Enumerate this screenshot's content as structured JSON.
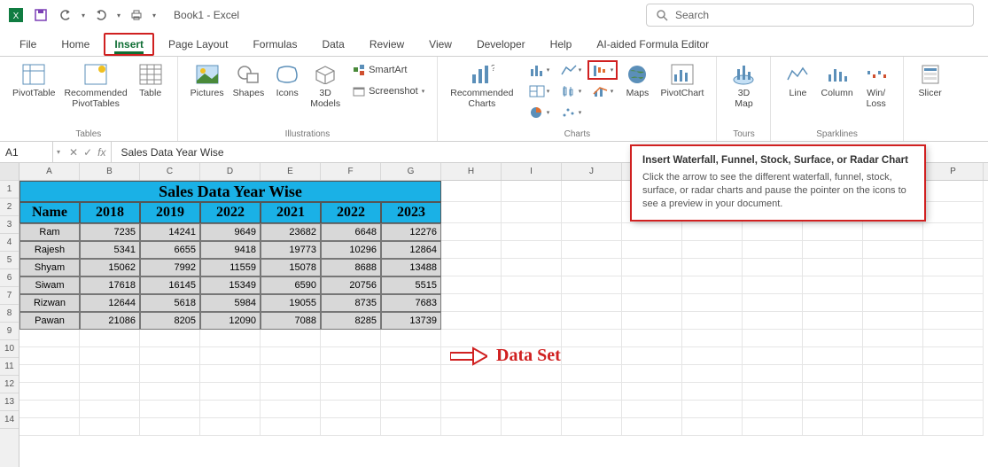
{
  "titlebar": {
    "doc_title": "Book1 - Excel",
    "search_placeholder": "Search"
  },
  "tabs": [
    "File",
    "Home",
    "Insert",
    "Page Layout",
    "Formulas",
    "Data",
    "Review",
    "View",
    "Developer",
    "Help",
    "AI-aided Formula Editor"
  ],
  "active_tab": "Insert",
  "ribbon": {
    "tables": {
      "label": "Tables",
      "pivot": "PivotTable",
      "recpivot": "Recommended\nPivotTables",
      "table": "Table"
    },
    "illus": {
      "label": "Illustrations",
      "pictures": "Pictures",
      "shapes": "Shapes",
      "icons": "Icons",
      "models": "3D\nModels",
      "smartart": "SmartArt",
      "screenshot": "Screenshot"
    },
    "charts": {
      "label": "Charts",
      "rec": "Recommended\nCharts",
      "maps": "Maps",
      "pivotchart": "PivotChart"
    },
    "tours": {
      "label": "Tours",
      "map": "3D\nMap"
    },
    "sparklines": {
      "label": "Sparklines",
      "line": "Line",
      "column": "Column",
      "winloss": "Win/\nLoss"
    },
    "filters": {
      "slicer": "Slicer"
    }
  },
  "namebox": "A1",
  "formula": "Sales Data Year Wise",
  "grid": {
    "cols": [
      "A",
      "B",
      "C",
      "D",
      "E",
      "F",
      "G",
      "H",
      "I",
      "J",
      "K",
      "L",
      "M",
      "N",
      "O",
      "P"
    ],
    "title": "Sales Data Year Wise",
    "headers": [
      "Name",
      "2018",
      "2019",
      "2022",
      "2021",
      "2022",
      "2023"
    ],
    "rows": [
      {
        "name": "Ram",
        "v": [
          "7235",
          "14241",
          "9649",
          "23682",
          "6648",
          "12276"
        ]
      },
      {
        "name": "Rajesh",
        "v": [
          "5341",
          "6655",
          "9418",
          "19773",
          "10296",
          "12864"
        ]
      },
      {
        "name": "Shyam",
        "v": [
          "15062",
          "7992",
          "11559",
          "15078",
          "8688",
          "13488"
        ]
      },
      {
        "name": "Siwam",
        "v": [
          "17618",
          "16145",
          "15349",
          "6590",
          "20756",
          "5515"
        ]
      },
      {
        "name": "Rizwan",
        "v": [
          "12644",
          "5618",
          "5984",
          "19055",
          "8735",
          "7683"
        ]
      },
      {
        "name": "Pawan",
        "v": [
          "21086",
          "8205",
          "12090",
          "7088",
          "8285",
          "13739"
        ]
      }
    ]
  },
  "tooltip": {
    "title": "Insert Waterfall, Funnel, Stock, Surface, or Radar Chart",
    "body": "Click the arrow to see the different waterfall, funnel, stock, surface, or radar charts and pause the pointer on the icons to see a preview in your document."
  },
  "annotation": {
    "label": "Data Set"
  }
}
